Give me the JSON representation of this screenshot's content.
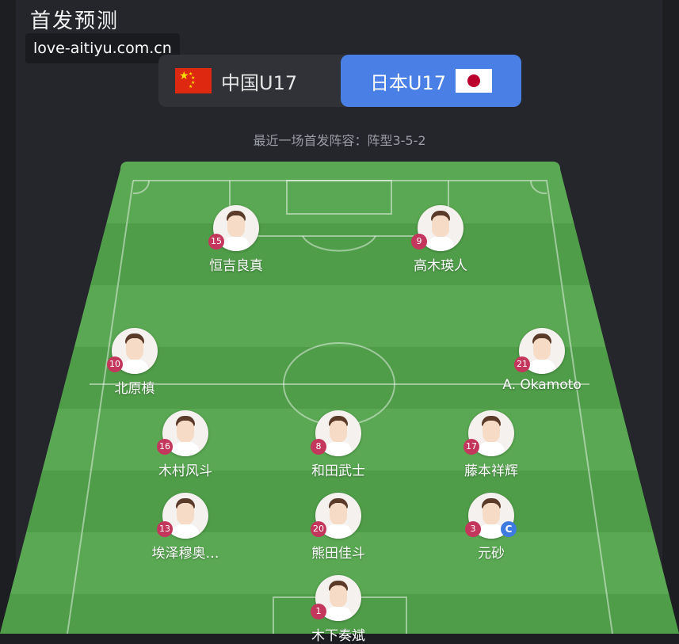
{
  "header": {
    "title": "首发预测"
  },
  "watermark": "love-aitiyu.com.cn",
  "teams": {
    "home": {
      "name": "中国U17",
      "flag": "china-flag-icon"
    },
    "away": {
      "name": "日本U17",
      "flag": "japan-flag-icon",
      "selected": true
    }
  },
  "formation_text": "最近一场首发阵容：阵型3-5-2",
  "colors": {
    "accent": "#4a7fe6",
    "number_badge": "#c4375d",
    "captain_badge": "#3f7ae0",
    "pitch_light": "#5fad57",
    "pitch_dark": "#4f9d49"
  },
  "players": [
    {
      "number": "15",
      "name": "恒吉良真"
    },
    {
      "number": "9",
      "name": "高木瑛人"
    },
    {
      "number": "10",
      "name": "北原槙"
    },
    {
      "number": "21",
      "name": "A. Okamoto"
    },
    {
      "number": "16",
      "name": "木村风斗"
    },
    {
      "number": "8",
      "name": "和田武士"
    },
    {
      "number": "17",
      "name": "藤本祥辉"
    },
    {
      "number": "13",
      "name": "埃泽穆奥…"
    },
    {
      "number": "20",
      "name": "熊田佳斗"
    },
    {
      "number": "3",
      "name": "元砂",
      "captain": "C"
    },
    {
      "number": "1",
      "name": "木下奏斌"
    }
  ]
}
